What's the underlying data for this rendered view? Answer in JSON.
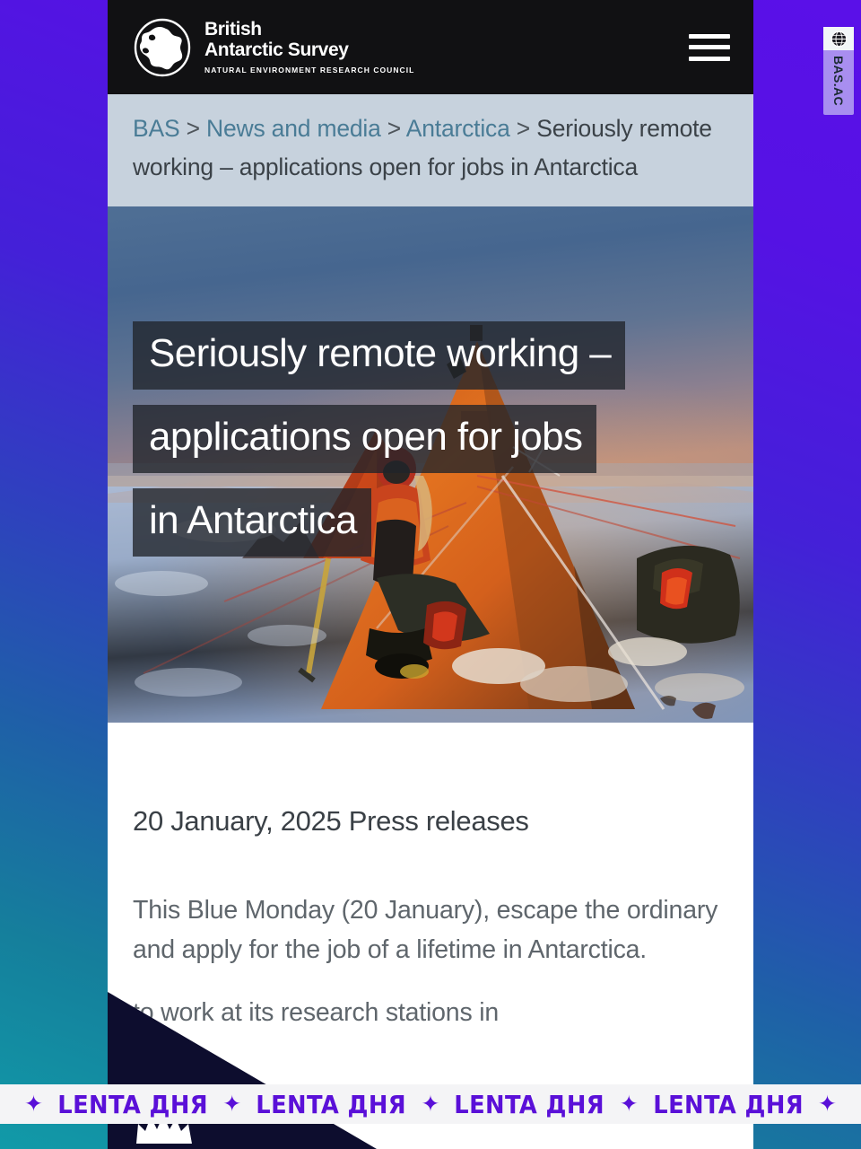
{
  "header": {
    "logo_icon": "antarctica-continent-icon",
    "brand_line1": "British",
    "brand_line2": "Antarctic Survey",
    "brand_subtitle": "NATURAL ENVIRONMENT RESEARCH COUNCIL",
    "menu_icon": "hamburger-menu-icon",
    "background_color": "#111113"
  },
  "breadcrumb": {
    "items": [
      {
        "label": "BAS",
        "is_link": true
      },
      {
        "label": "News and media",
        "is_link": true
      },
      {
        "label": "Antarctica",
        "is_link": true
      },
      {
        "label": "Seriously remote working – applications open for jobs in Antarctica",
        "is_link": false
      }
    ],
    "separator": ">",
    "background_color": "#c7d2dd",
    "link_color": "#4a7c96"
  },
  "hero": {
    "alt_description": "orange pyramid tent on snow at sunset in Antarctica",
    "title_lines": [
      "Seriously remote working –",
      "applications open for jobs",
      "in Antarctica"
    ]
  },
  "article": {
    "date": "20 January, 2025",
    "category": "Press releases",
    "meta_line": "20 January, 2025 Press releases",
    "standfirst": "This Blue Monday (20 January), escape the ordinary and apply for the job of a lifetime in Antarctica.",
    "body_visible": "to work at its research stations in"
  },
  "side_tab": {
    "icon": "globe-icon",
    "label": "BAS.AC"
  },
  "marquee": {
    "star_glyph": "✦",
    "text": "LENTA ДНЯ",
    "repeat_count": 4,
    "text_color": "#5a10d8",
    "background_color": "#f4f4f6"
  },
  "background": {
    "gradient_from": "#5a10e8",
    "gradient_to": "#119aa8"
  }
}
